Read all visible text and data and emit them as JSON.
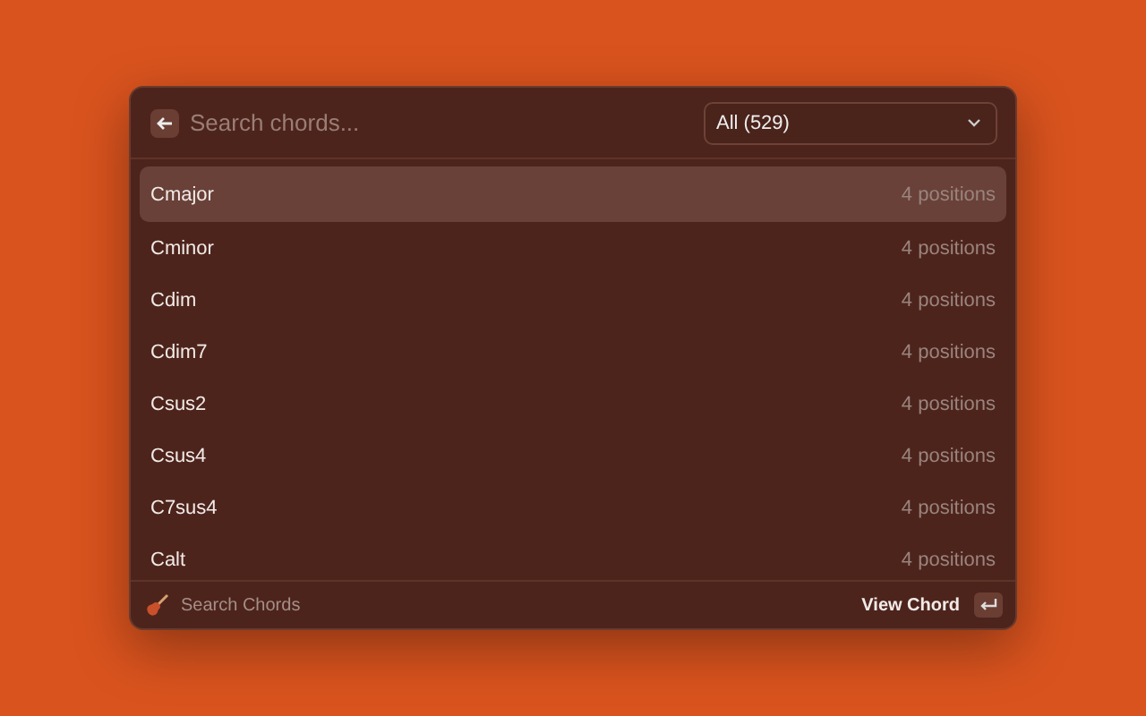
{
  "search": {
    "placeholder": "Search chords..."
  },
  "filter": {
    "value": "All (529)"
  },
  "chords": [
    {
      "name": "Cmajor",
      "positions": "4 positions",
      "selected": true
    },
    {
      "name": "Cminor",
      "positions": "4 positions",
      "selected": false
    },
    {
      "name": "Cdim",
      "positions": "4 positions",
      "selected": false
    },
    {
      "name": "Cdim7",
      "positions": "4 positions",
      "selected": false
    },
    {
      "name": "Csus2",
      "positions": "4 positions",
      "selected": false
    },
    {
      "name": "Csus4",
      "positions": "4 positions",
      "selected": false
    },
    {
      "name": "C7sus4",
      "positions": "4 positions",
      "selected": false
    },
    {
      "name": "Calt",
      "positions": "4 positions",
      "selected": false
    }
  ],
  "footer": {
    "title": "Search Chords",
    "action": "View Chord"
  }
}
